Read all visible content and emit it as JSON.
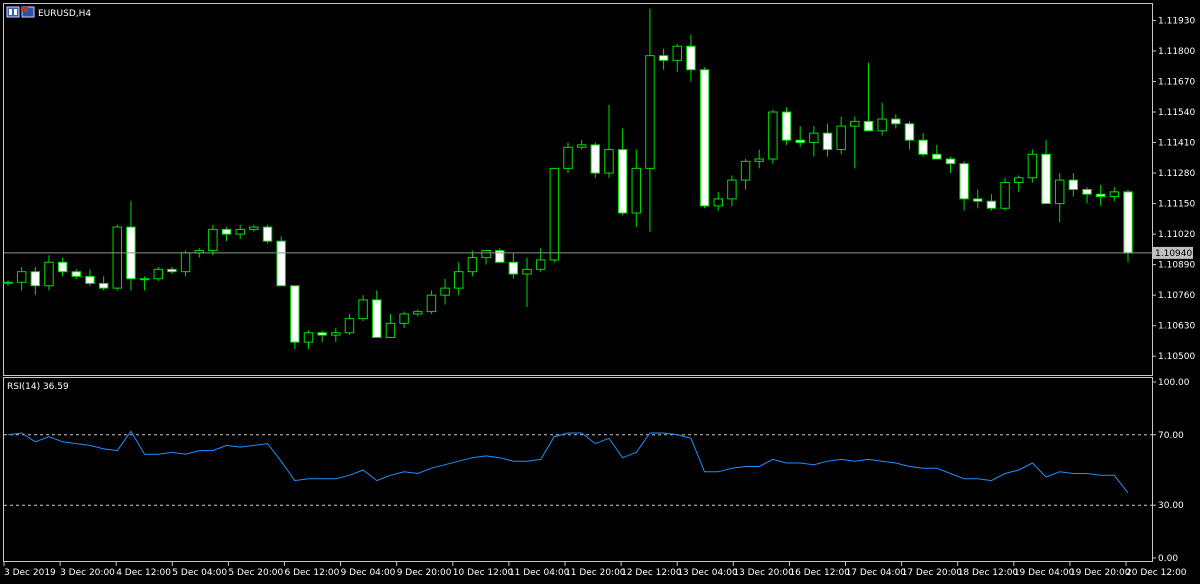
{
  "window": {
    "title": "EURUSD,H4"
  },
  "colors": {
    "background": "#000000",
    "frame": "#c8c8c8",
    "bull_body": "#000000",
    "bear_body": "#ffffff",
    "wick": "#00dd00",
    "rsi_line": "#1e90ff",
    "level_line": "#c8c8c8",
    "bid_line": "#8a9a8a",
    "price_tag_bg": "#c0c0c0",
    "price_tag_fg": "#000000"
  },
  "chart_data": [
    {
      "type": "candlestick",
      "symbol": "EURUSD",
      "timeframe": "H4",
      "ylim": [
        1.1042,
        1.12
      ],
      "yticks": [
        "1.11930",
        "1.11800",
        "1.11670",
        "1.11540",
        "1.11410",
        "1.11280",
        "1.11150",
        "1.11020",
        "1.10890",
        "1.10760",
        "1.10630",
        "1.10500"
      ],
      "current_price": "1.10940",
      "xticks": [
        "3 Dec 2019",
        "3 Dec 20:00",
        "4 Dec 12:00",
        "5 Dec 04:00",
        "5 Dec 20:00",
        "6 Dec 12:00",
        "9 Dec 04:00",
        "9 Dec 20:00",
        "10 Dec 12:00",
        "11 Dec 04:00",
        "11 Dec 20:00",
        "12 Dec 12:00",
        "13 Dec 04:00",
        "13 Dec 20:00",
        "16 Dec 12:00",
        "17 Dec 04:00",
        "17 Dec 20:00",
        "18 Dec 12:00",
        "19 Dec 04:00",
        "19 Dec 20:00",
        "20 Dec 12:00"
      ],
      "candles": [
        [
          1.10815,
          1.10822,
          1.108,
          1.10815
        ],
        [
          1.10815,
          1.1088,
          1.1078,
          1.1086
        ],
        [
          1.1086,
          1.1088,
          1.1076,
          1.108
        ],
        [
          1.108,
          1.1093,
          1.1078,
          1.109
        ],
        [
          1.109,
          1.1092,
          1.1084,
          1.1086
        ],
        [
          1.1086,
          1.1087,
          1.1083,
          1.1084
        ],
        [
          1.1084,
          1.1087,
          1.108,
          1.1081
        ],
        [
          1.1081,
          1.1084,
          1.1078,
          1.1079
        ],
        [
          1.1079,
          1.1106,
          1.1078,
          1.1105
        ],
        [
          1.1105,
          1.1116,
          1.1078,
          1.1083
        ],
        [
          1.1083,
          1.1084,
          1.1078,
          1.1083
        ],
        [
          1.1083,
          1.1088,
          1.1082,
          1.1087
        ],
        [
          1.1087,
          1.1088,
          1.1085,
          1.1086
        ],
        [
          1.1086,
          1.1095,
          1.1084,
          1.1094
        ],
        [
          1.1094,
          1.1096,
          1.1092,
          1.1095
        ],
        [
          1.1095,
          1.1106,
          1.1093,
          1.1104
        ],
        [
          1.1104,
          1.1105,
          1.1099,
          1.1102
        ],
        [
          1.1102,
          1.1106,
          1.11,
          1.1104
        ],
        [
          1.1104,
          1.1106,
          1.1103,
          1.1105
        ],
        [
          1.1105,
          1.1106,
          1.1098,
          1.1099
        ],
        [
          1.1099,
          1.1101,
          1.108,
          1.108
        ],
        [
          1.108,
          1.108,
          1.1053,
          1.1056
        ],
        [
          1.1056,
          1.1061,
          1.1053,
          1.106
        ],
        [
          1.106,
          1.1061,
          1.1056,
          1.1059
        ],
        [
          1.1059,
          1.1062,
          1.1056,
          1.106
        ],
        [
          1.106,
          1.1068,
          1.1059,
          1.1066
        ],
        [
          1.1066,
          1.1076,
          1.1065,
          1.1074
        ],
        [
          1.1074,
          1.1078,
          1.1058,
          1.1058
        ],
        [
          1.1058,
          1.1068,
          1.1058,
          1.1064
        ],
        [
          1.1064,
          1.1069,
          1.1062,
          1.1068
        ],
        [
          1.1068,
          1.107,
          1.1067,
          1.1069
        ],
        [
          1.1069,
          1.1078,
          1.1068,
          1.1076
        ],
        [
          1.1076,
          1.1083,
          1.1072,
          1.1079
        ],
        [
          1.1079,
          1.109,
          1.1076,
          1.1086
        ],
        [
          1.1086,
          1.1095,
          1.1084,
          1.1092
        ],
        [
          1.1092,
          1.1095,
          1.1089,
          1.1095
        ],
        [
          1.1095,
          1.1096,
          1.109,
          1.109
        ],
        [
          1.109,
          1.1094,
          1.1083,
          1.1085
        ],
        [
          1.1085,
          1.1092,
          1.1071,
          1.1087
        ],
        [
          1.1087,
          1.1096,
          1.1086,
          1.1091
        ],
        [
          1.1091,
          1.113,
          1.109,
          1.113
        ],
        [
          1.113,
          1.1141,
          1.1128,
          1.1139
        ],
        [
          1.1139,
          1.1142,
          1.1138,
          1.114
        ],
        [
          1.114,
          1.1141,
          1.1126,
          1.1128
        ],
        [
          1.1128,
          1.1157,
          1.1126,
          1.1138
        ],
        [
          1.1138,
          1.1147,
          1.111,
          1.1111
        ],
        [
          1.1111,
          1.1138,
          1.1105,
          1.113
        ],
        [
          1.113,
          1.1198,
          1.1103,
          1.1178
        ],
        [
          1.1178,
          1.1181,
          1.1172,
          1.1176
        ],
        [
          1.1176,
          1.1183,
          1.1171,
          1.1182
        ],
        [
          1.1182,
          1.1187,
          1.1167,
          1.1172
        ],
        [
          1.1172,
          1.1173,
          1.1113,
          1.1114
        ],
        [
          1.1114,
          1.112,
          1.1112,
          1.1117
        ],
        [
          1.1117,
          1.1127,
          1.1114,
          1.1125
        ],
        [
          1.1125,
          1.1134,
          1.1121,
          1.1133
        ],
        [
          1.1133,
          1.1138,
          1.113,
          1.1134
        ],
        [
          1.1134,
          1.1155,
          1.1132,
          1.1154
        ],
        [
          1.1154,
          1.1156,
          1.114,
          1.1142
        ],
        [
          1.1142,
          1.1148,
          1.1139,
          1.1141
        ],
        [
          1.1141,
          1.1148,
          1.1135,
          1.1145
        ],
        [
          1.1145,
          1.1149,
          1.1135,
          1.1138
        ],
        [
          1.1138,
          1.1152,
          1.1136,
          1.1148
        ],
        [
          1.1148,
          1.1152,
          1.113,
          1.115
        ],
        [
          1.115,
          1.1175,
          1.1146,
          1.1146
        ],
        [
          1.1146,
          1.1158,
          1.1144,
          1.1151
        ],
        [
          1.1151,
          1.1153,
          1.1147,
          1.1149
        ],
        [
          1.1149,
          1.115,
          1.1138,
          1.1142
        ],
        [
          1.1142,
          1.1145,
          1.1135,
          1.1136
        ],
        [
          1.1136,
          1.114,
          1.1134,
          1.1134
        ],
        [
          1.1134,
          1.1135,
          1.1128,
          1.1132
        ],
        [
          1.1132,
          1.1133,
          1.1112,
          1.1117
        ],
        [
          1.1117,
          1.1121,
          1.1113,
          1.1116
        ],
        [
          1.1116,
          1.1119,
          1.1112,
          1.1113
        ],
        [
          1.1113,
          1.1126,
          1.1112,
          1.1124
        ],
        [
          1.1124,
          1.1127,
          1.112,
          1.1126
        ],
        [
          1.1126,
          1.1138,
          1.1124,
          1.1136
        ],
        [
          1.1136,
          1.1142,
          1.1115,
          1.1115
        ],
        [
          1.1115,
          1.1128,
          1.1107,
          1.1125
        ],
        [
          1.1125,
          1.1128,
          1.1118,
          1.1121
        ],
        [
          1.1121,
          1.1122,
          1.1115,
          1.1119
        ],
        [
          1.1119,
          1.1123,
          1.1114,
          1.1118
        ],
        [
          1.1118,
          1.1122,
          1.1116,
          1.112
        ],
        [
          1.112,
          1.1121,
          1.109,
          1.1094
        ]
      ]
    },
    {
      "type": "line",
      "title": "RSI(14) 36.59",
      "ylim": [
        0,
        100
      ],
      "yticks": [
        "100.00",
        "70.00",
        "30.00",
        "0.00"
      ],
      "levels": [
        70,
        30
      ],
      "values": [
        70,
        71,
        66,
        69,
        66,
        65,
        64,
        62,
        61,
        72,
        59,
        59,
        60,
        59,
        61,
        61,
        64,
        63,
        64,
        65,
        55,
        44,
        45,
        45,
        45,
        47,
        50,
        44,
        47,
        49,
        48,
        51,
        53,
        55,
        57,
        58,
        57,
        55,
        55,
        56,
        69,
        71,
        71,
        65,
        68,
        57,
        60,
        71,
        71,
        70,
        68,
        49,
        49,
        51,
        52,
        52,
        56,
        54,
        54,
        53,
        55,
        56,
        55,
        56,
        55,
        54,
        52,
        51,
        51,
        48,
        45,
        45,
        44,
        48,
        50,
        54,
        46,
        49,
        48,
        48,
        47,
        47,
        37
      ]
    }
  ]
}
